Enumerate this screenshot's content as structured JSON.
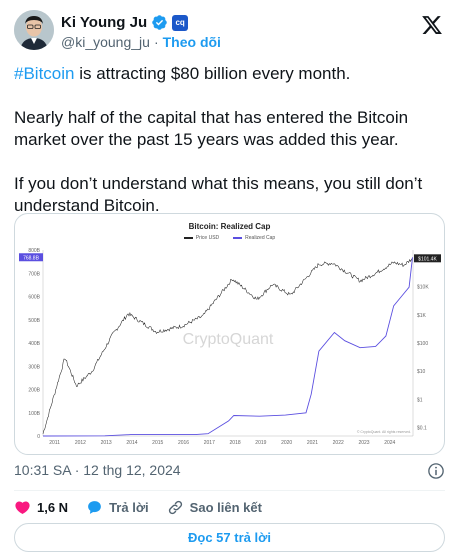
{
  "author": {
    "name": "Ki Young Ju",
    "handle": "@ki_young_ju",
    "follow_label": "Theo dõi",
    "separator": "·"
  },
  "tweet": {
    "hashtag": "#Bitcoin",
    "line1_rest": " is attracting $80 billion every month.",
    "paragraph2": "Nearly half of the capital that has entered the Bitcoin market over the past 15 years was added this year.",
    "paragraph3": "If you don’t understand what this means, you still don’t understand Bitcoin."
  },
  "meta": {
    "timestamp": "10:31 SA · 12 thg 12, 2024"
  },
  "actions": {
    "likes": "1,6 N",
    "reply_label": "Trả lời",
    "copy_link_label": "Sao liên kết"
  },
  "read_replies_label": "Đọc 57 trả lời",
  "colors": {
    "accent": "#1d9bf0",
    "price_line": "#222222",
    "realized_cap_line": "#5b4fe0",
    "like": "#f91880"
  },
  "chart_data": {
    "type": "line",
    "title": "Bitcoin: Realized Cap",
    "legend": [
      "Price USD",
      "Realized Cap"
    ],
    "watermark": "CryptoQuant",
    "credit": "© CryptoQuant. All rights reserved.",
    "x_ticks": [
      "2011",
      "2012",
      "2013",
      "2014",
      "2015",
      "2016",
      "2017",
      "2018",
      "2019",
      "2020",
      "2021",
      "2022",
      "2023",
      "2024"
    ],
    "left_axis_ticks": [
      "800B",
      "700B",
      "600B",
      "500B",
      "400B",
      "300B",
      "200B",
      "100B",
      "0"
    ],
    "right_axis_ticks": [
      "$10K",
      "$1K",
      "$100",
      "$10",
      "$1",
      "$0.1"
    ],
    "left_current_label": "768.8B",
    "right_current_label": "$101.4K",
    "series": [
      {
        "name": "Realized Cap",
        "axis": "left",
        "x": [
          2010.6,
          2013.0,
          2014.0,
          2016.5,
          2017.0,
          2017.8,
          2018.0,
          2019.0,
          2020.0,
          2020.8,
          2021.0,
          2021.3,
          2021.9,
          2022.3,
          2022.9,
          2023.5,
          2023.9,
          2024.2,
          2024.5,
          2024.8,
          2024.93
        ],
        "y": [
          0,
          1,
          6,
          6,
          10,
          65,
          88,
          85,
          90,
          100,
          180,
          365,
          445,
          410,
          380,
          385,
          430,
          560,
          600,
          640,
          768.8
        ]
      },
      {
        "name": "Price USD",
        "axis": "right-log",
        "x": [
          2010.6,
          2011.45,
          2011.9,
          2012.5,
          2013.3,
          2013.9,
          2015.0,
          2016.0,
          2016.8,
          2017.95,
          2018.9,
          2019.5,
          2020.2,
          2021.3,
          2021.85,
          2022.9,
          2023.5,
          2024.2,
          2024.6,
          2024.93
        ],
        "y": [
          0.06,
          30,
          3,
          10,
          200,
          1100,
          250,
          400,
          900,
          19000,
          3500,
          12000,
          5000,
          63000,
          68000,
          16000,
          30000,
          72000,
          58000,
          101400
        ]
      }
    ],
    "xlim": [
      2010.6,
      2024.95
    ],
    "left_ylim": [
      0,
      800
    ],
    "right_log_ylim": [
      0.05,
      200000
    ]
  }
}
